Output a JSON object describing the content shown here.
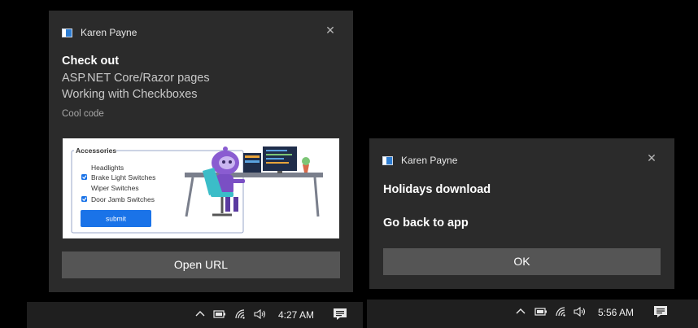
{
  "toast1": {
    "app_name": "Karen Payne",
    "close_glyph": "✕",
    "title": "Check out",
    "line1": "ASP.NET Core/Razor pages",
    "line2": "Working with Checkboxes",
    "attribution": "Cool code",
    "hero": {
      "group_title": "Accessories",
      "items": [
        {
          "label": "Headlights",
          "checked": false
        },
        {
          "label": "Brake Light Switches",
          "checked": true
        },
        {
          "label": "Wiper Switches",
          "checked": false
        },
        {
          "label": "Door Jamb Switches",
          "checked": true
        }
      ],
      "submit_label": "submit"
    },
    "action_label": "Open URL"
  },
  "toast2": {
    "app_name": "Karen Payne",
    "close_glyph": "✕",
    "line1": "Holidays download",
    "line2": "Go back to app",
    "action_label": "OK"
  },
  "taskbar1": {
    "time": "4:27 AM"
  },
  "taskbar2": {
    "time": "5:56 AM"
  },
  "colors": {
    "toast_bg": "#2b2b2b",
    "button_bg": "#555555",
    "accent": "#1a73e8"
  }
}
